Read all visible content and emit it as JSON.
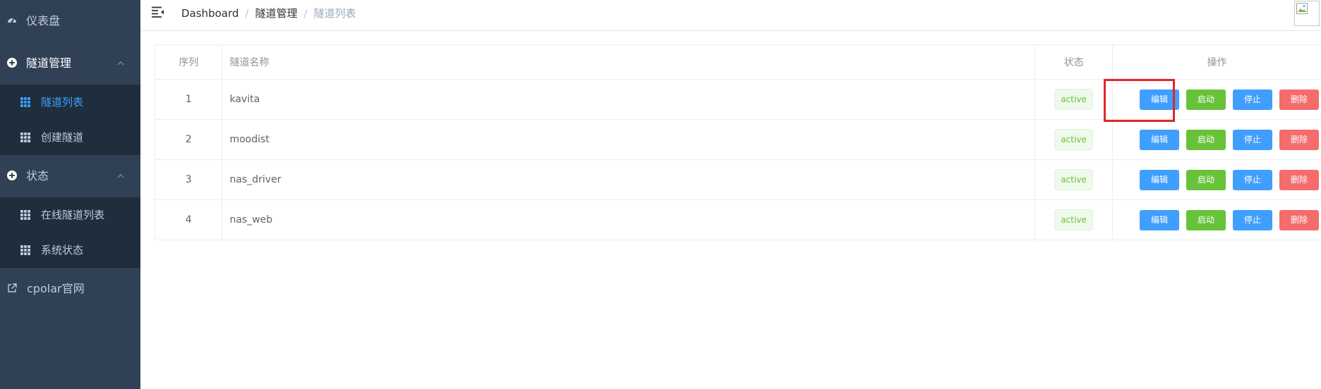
{
  "sidebar": {
    "dashboard_label": "仪表盘",
    "tunnel_group": {
      "label": "隧道管理",
      "items": [
        {
          "label": "隧道列表",
          "active": true
        },
        {
          "label": "创建隧道",
          "active": false
        }
      ]
    },
    "status_group": {
      "label": "状态",
      "items": [
        {
          "label": "在线隧道列表"
        },
        {
          "label": "系统状态"
        }
      ]
    },
    "external_link_label": "cpolar官网"
  },
  "breadcrumb": [
    "Dashboard",
    "隧道管理",
    "隧道列表"
  ],
  "table": {
    "headers": [
      "序列",
      "隧道名称",
      "状态",
      "操作"
    ],
    "rows": [
      {
        "index": "1",
        "name": "kavita",
        "status": "active"
      },
      {
        "index": "2",
        "name": "moodist",
        "status": "active"
      },
      {
        "index": "3",
        "name": "nas_driver",
        "status": "active"
      },
      {
        "index": "4",
        "name": "nas_web",
        "status": "active"
      }
    ],
    "actions": {
      "edit": "编辑",
      "start": "启动",
      "stop": "停止",
      "delete": "删除"
    }
  },
  "colors": {
    "sidebar_bg": "#304156",
    "submenu_bg": "#1f2d3d",
    "accent": "#409eff",
    "success": "#67c23a",
    "danger": "#f56c6c",
    "highlight": "#e0262a"
  },
  "icons": {
    "dashboard": "dashboard-gauge-icon",
    "tunnel_group": "circle-plus-icon",
    "status_group": "circle-plus-icon",
    "sub_items": "table-grid-icon",
    "external": "external-link-icon",
    "hamburger": "hamburger-fold-icon",
    "avatar": "broken-image-icon"
  }
}
